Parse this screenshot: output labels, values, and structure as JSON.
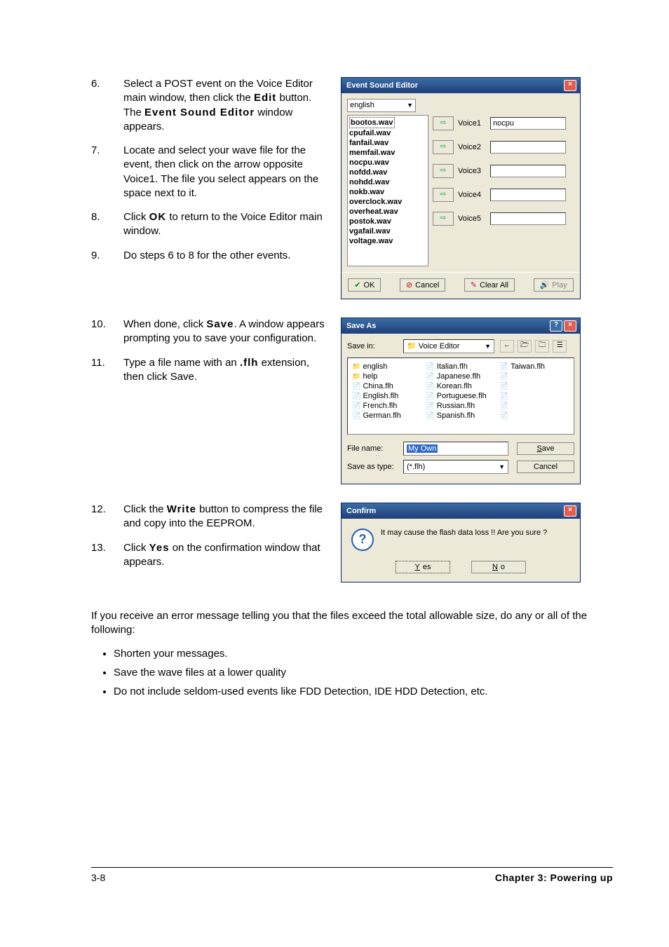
{
  "steps": {
    "s6": {
      "num": "6.",
      "pre": "Select a POST event on the Voice Editor main window, then click the ",
      "b1": "Edit",
      "mid": " button. The ",
      "b2": "Event Sound Editor",
      "post": " window appears."
    },
    "s7": {
      "num": "7.",
      "text": "Locate and select your wave file for the event, then click on the arrow opposite Voice1. The file you select appears on the space next to it."
    },
    "s8": {
      "num": "8.",
      "pre": "Click ",
      "b1": "OK",
      "post": " to return to the Voice Editor main window."
    },
    "s9": {
      "num": "9.",
      "text": "Do steps 6 to 8 for the other events."
    },
    "s10": {
      "num": "10.",
      "pre": "When done, click ",
      "b1": "Save",
      "post": ". A window appears prompting you to save your configuration."
    },
    "s11": {
      "num": "11.",
      "pre": "Type a file name with an ",
      "b1": ".flh",
      "post": " extension, then click Save."
    },
    "s12": {
      "num": "12.",
      "pre": "Click the ",
      "b1": "Write",
      "post": " button to compress the file and copy into the EEPROM."
    },
    "s13": {
      "num": "13.",
      "pre": "Click ",
      "b1": "Yes",
      "post": " on the confirmation window that appears."
    }
  },
  "error_para": "If you receive an error message telling you that the files exceed the total allowable size, do any or all of the following:",
  "bullets": {
    "b1": "Shorten your messages.",
    "b2": "Save the wave files at a lower quality",
    "b3": "Do not include seldom-used events like FDD Detection, IDE HDD Detection, etc."
  },
  "ese": {
    "title": "Event Sound Editor",
    "lang": "english",
    "list": [
      "bootos.wav",
      "cpufail.wav",
      "fanfail.wav",
      "memfail.wav",
      "nocpu.wav",
      "nofdd.wav",
      "nohdd.wav",
      "nokb.wav",
      "overclock.wav",
      "overheat.wav",
      "postok.wav",
      "vgafail.wav",
      "voltage.wav"
    ],
    "rows": [
      {
        "label": "Voice1",
        "value": "nocpu"
      },
      {
        "label": "Voice2",
        "value": ""
      },
      {
        "label": "Voice3",
        "value": ""
      },
      {
        "label": "Voice4",
        "value": ""
      },
      {
        "label": "Voice5",
        "value": ""
      }
    ],
    "ok": "OK",
    "cancel": "Cancel",
    "clear": "Clear All",
    "play": "Play"
  },
  "saveas": {
    "title": "Save As",
    "savein_lbl": "Save in:",
    "savein_val": "Voice Editor",
    "files_col1": [
      "english",
      "help",
      "China.flh",
      "English.flh",
      "French.flh",
      "German.flh"
    ],
    "files_col2": [
      "Italian.flh",
      "Japanese.flh",
      "Korean.flh",
      "Portuguese.flh",
      "Russian.flh",
      "Spanish.flh"
    ],
    "files_col3": [
      "Taiwan.flh"
    ],
    "filename_lbl": "File name:",
    "filename_val": "My Own",
    "type_lbl": "Save as type:",
    "type_val": "(*.flh)",
    "save_btn": "Save",
    "cancel_btn": "Cancel"
  },
  "confirm": {
    "title": "Confirm",
    "msg": "It may cause the flash data loss !!  Are you sure ?",
    "yes": "Yes",
    "no": "No"
  },
  "footer": {
    "left": "3-8",
    "right": "Chapter 3: Powering up"
  }
}
